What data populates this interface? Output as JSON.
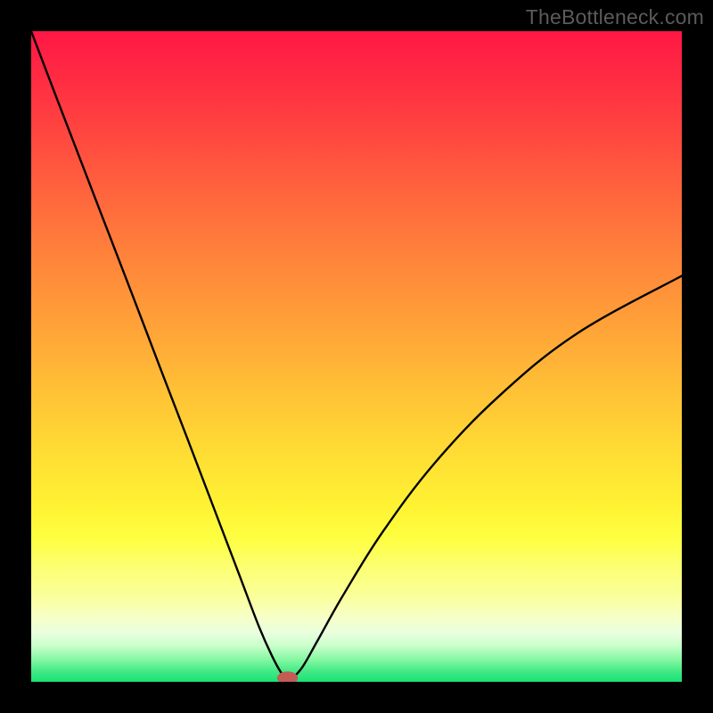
{
  "watermark": "TheBottleneck.com",
  "gradient": {
    "stops": [
      {
        "offset": 0.0,
        "color": "#ff1745"
      },
      {
        "offset": 0.07,
        "color": "#ff2b42"
      },
      {
        "offset": 0.15,
        "color": "#ff4440"
      },
      {
        "offset": 0.25,
        "color": "#ff653d"
      },
      {
        "offset": 0.35,
        "color": "#ff843b"
      },
      {
        "offset": 0.45,
        "color": "#ffa138"
      },
      {
        "offset": 0.55,
        "color": "#ffc036"
      },
      {
        "offset": 0.65,
        "color": "#ffdd34"
      },
      {
        "offset": 0.73,
        "color": "#fff233"
      },
      {
        "offset": 0.78,
        "color": "#feff41"
      },
      {
        "offset": 0.82,
        "color": "#fcff6e"
      },
      {
        "offset": 0.87,
        "color": "#faff9d"
      },
      {
        "offset": 0.9,
        "color": "#f7ffc6"
      },
      {
        "offset": 0.925,
        "color": "#e9ffde"
      },
      {
        "offset": 0.945,
        "color": "#c8ffcb"
      },
      {
        "offset": 0.965,
        "color": "#88f8a3"
      },
      {
        "offset": 0.985,
        "color": "#3ee983"
      },
      {
        "offset": 1.0,
        "color": "#19e276"
      }
    ]
  },
  "chart_data": {
    "type": "line",
    "title": "",
    "xlabel": "",
    "ylabel": "",
    "xlim": [
      0,
      100
    ],
    "ylim": [
      0,
      100
    ],
    "series": [
      {
        "name": "bottleneck-curve",
        "x": [
          0,
          4,
          8,
          12,
          16,
          20,
          24,
          28,
          32,
          35,
          37,
          38.5,
          39.6,
          41.5,
          44,
          48,
          54,
          62,
          72,
          84,
          100
        ],
        "y": [
          100,
          89.5,
          79.1,
          68.7,
          58.3,
          47.8,
          37.4,
          26.9,
          16.4,
          8.5,
          4.0,
          1.3,
          0.4,
          2.0,
          6.3,
          13.4,
          23.0,
          33.6,
          44.0,
          53.6,
          62.4
        ]
      }
    ],
    "marker": {
      "x": 39.4,
      "y": 0.6,
      "rx": 1.6,
      "ry": 1.0,
      "color": "#c35c57"
    },
    "grid": false,
    "legend": false
  }
}
